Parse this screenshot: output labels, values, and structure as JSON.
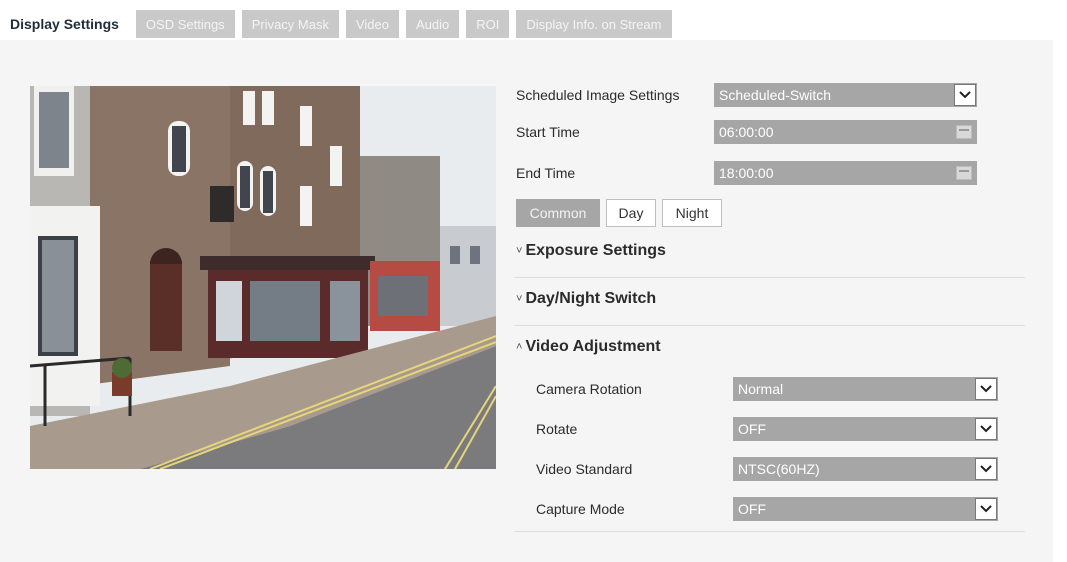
{
  "tabs": [
    {
      "label": "Display Settings",
      "active": true
    },
    {
      "label": "OSD Settings",
      "active": false
    },
    {
      "label": "Privacy Mask",
      "active": false
    },
    {
      "label": "Video",
      "active": false
    },
    {
      "label": "Audio",
      "active": false
    },
    {
      "label": "ROI",
      "active": false
    },
    {
      "label": "Display Info. on Stream",
      "active": false
    }
  ],
  "schedule": {
    "label": "Scheduled Image Settings",
    "value": "Scheduled-Switch",
    "start_label": "Start Time",
    "start_value": "06:00:00",
    "end_label": "End Time",
    "end_value": "18:00:00"
  },
  "modes": {
    "common": "Common",
    "day": "Day",
    "night": "Night",
    "selected": "Common"
  },
  "sections": {
    "exposure": {
      "title": "Exposure Settings",
      "caret": "˅"
    },
    "daynight": {
      "title": "Day/Night Switch",
      "caret": "˅"
    },
    "video_adjust": {
      "title": "Video Adjustment",
      "caret": "˄"
    }
  },
  "video_adjustment": {
    "camera_rotation": {
      "label": "Camera Rotation",
      "value": "Normal"
    },
    "rotate": {
      "label": "Rotate",
      "value": "OFF"
    },
    "video_standard": {
      "label": "Video Standard",
      "value": "NTSC(60HZ)"
    },
    "capture_mode": {
      "label": "Capture Mode",
      "value": "OFF"
    }
  },
  "colors": {
    "field_bg": "#a6a6a6",
    "inactive_tab_bg": "#c9c9c9",
    "panel_bg": "#f5f5f5"
  }
}
